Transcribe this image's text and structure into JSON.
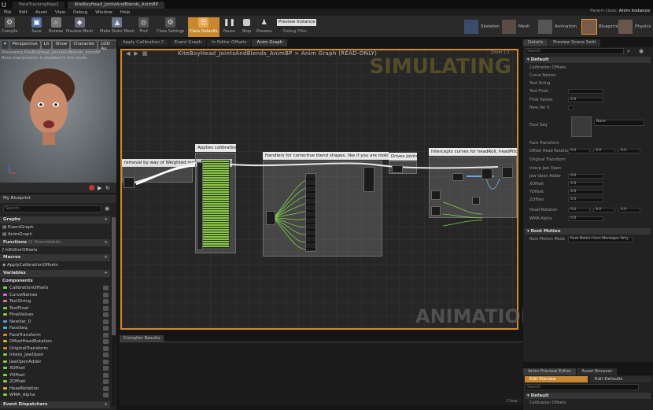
{
  "titlebar": {
    "tabs": [
      "FaceTrackingMap2",
      "KiteBoyHead_JointsAndBlends_AnimBP"
    ],
    "project_tag": "Parent class:",
    "instance_label": "Anim Instance"
  },
  "menu": [
    "File",
    "Edit",
    "Asset",
    "View",
    "Debug",
    "Window",
    "Help"
  ],
  "toolbar": {
    "buttons": [
      "Compile",
      "Save",
      "Browse",
      "Preview Mesh",
      "Make Static Mesh",
      "Find",
      "Class Settings",
      "Class Defaults",
      "Pause",
      "Stop",
      "Possess"
    ],
    "debug_instance": "Preview Instance",
    "debug_filter": "Debug Filter",
    "modes": [
      "Skeleton",
      "Mesh",
      "Animation",
      "Blueprint",
      "Physics"
    ]
  },
  "viewport": {
    "buttons": [
      "Perspective",
      "Lit",
      "Show",
      "Character",
      "LOD Au"
    ],
    "note_line1": "Previewing KiteBoyHead_JointsAndBlends_AnimBP",
    "note_line2": "Bone manipulation is disabled in this mode."
  },
  "my_blueprint": {
    "tab": "My Blueprint",
    "search_placeholder": "Search",
    "graphs_label": "Graphs",
    "graphs": [
      "EventGraph",
      "AnimGraph"
    ],
    "functions_label": "Functions",
    "functions_count": "(1 Overridable)",
    "functions": [
      "InEditorOffsets"
    ],
    "macros_label": "Macros",
    "macros": [
      "ApplyCalibrationOffsets"
    ],
    "variables_label": "Variables",
    "components_label": "Components",
    "variables": [
      "CalibrationOffsets",
      "CurveNames",
      "TestString",
      "TestFloat",
      "FinalValues",
      "NewVar_0",
      "FaceSeq",
      "FaceTransform",
      "OffsetHeadRotation",
      "OriginalTransform",
      "Interp_JawOpen",
      "JawOpenAdder",
      "XOffset",
      "YOffset",
      "ZOffset",
      "HeadRotation",
      "WMA_Alpha"
    ],
    "event_dispatchers_label": "Event Dispatchers"
  },
  "graph": {
    "tabs": [
      "Apply Calibration C",
      "Event Graph",
      "In Editor Offsets",
      "Anim Graph"
    ],
    "path_bp": "KiteBoyHead_JointsAndBlends_AnimBP",
    "path_sep": ">",
    "path_graph": "Anim Graph",
    "path_state": "(READ-ONLY)",
    "zoom": "Zoom 1:1",
    "watermark_top": "SIMULATING",
    "watermark_bottom": "ANIMATION",
    "comments": {
      "c1": "removal by way of Weighted moving average with",
      "c2": "Applies calibration",
      "c3": "Handlers for corrective blend shapes, like if you are looking both down and to the right at the same time",
      "c4": "Drives joints",
      "c5": "Intercepts curves for headRoll, headPitch a"
    }
  },
  "compiler": {
    "tab": "Compiler Results",
    "clear": "Clear"
  },
  "details": {
    "tabs": [
      "Details",
      "Preview Scene Setti"
    ],
    "search_placeholder": "Search",
    "default_label": "Default",
    "rows": [
      "Calibration Offsets",
      "Curve Names",
      "Test String",
      "Test Float",
      "Final Values",
      "New Var 0",
      "Face Seq",
      "Face Transform",
      "Offset Head Rotation",
      "Original Transform",
      "Interp Jaw Open",
      "Jaw Open Adder",
      "XOffset",
      "YOffset",
      "ZOffset",
      "Head Rotation",
      "WMA Alpha"
    ],
    "zero": "0.0",
    "none": "None",
    "root_motion_label": "Root Motion",
    "root_motion_mode_label": "Root Motion Mode",
    "root_motion_mode_value": "Root Motion from Montages Only"
  },
  "asset_preview": {
    "tabs": [
      "Anim Preview Editor",
      "Asset Browser"
    ],
    "edit_preview": "Edit Preview",
    "edit_defaults": "Edit Defaults",
    "search_placeholder": "Search",
    "default_label": "Default",
    "first_row": "Calibration Offsets"
  }
}
